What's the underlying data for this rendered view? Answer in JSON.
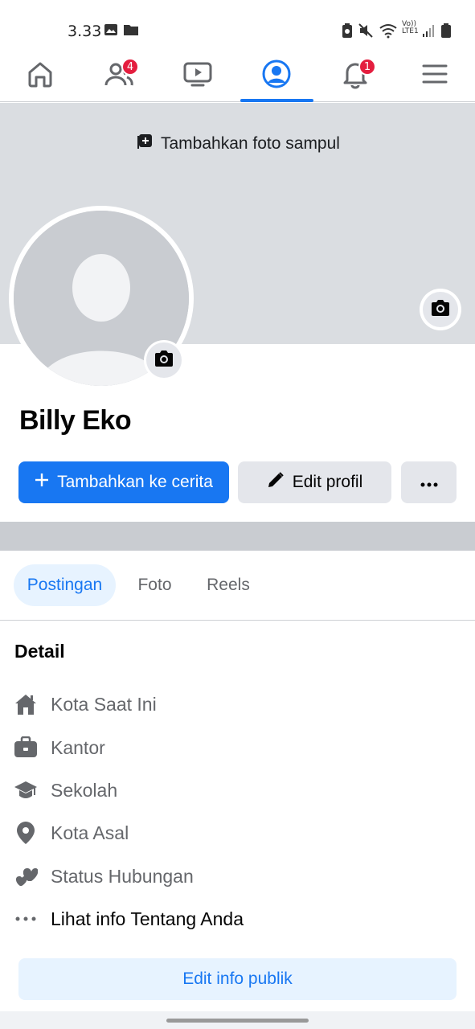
{
  "status_bar": {
    "time": "3.33",
    "network_label_top": "Vo))",
    "network_label_bottom": "LTE1"
  },
  "nav": {
    "items": [
      {
        "icon": "home-icon"
      },
      {
        "icon": "friends-icon",
        "badge": "4"
      },
      {
        "icon": "video-icon"
      },
      {
        "icon": "profile-icon",
        "active": true
      },
      {
        "icon": "bell-icon",
        "badge": "1"
      },
      {
        "icon": "menu-icon"
      }
    ],
    "accent": "#1877f2",
    "badge_color": "#e41e3f"
  },
  "cover": {
    "add_cover_label": "Tambahkan foto sampul"
  },
  "profile": {
    "name": "Billy Eko"
  },
  "actions": {
    "add_story_label": "Tambahkan ke cerita",
    "edit_profile_label": "Edit profil"
  },
  "tabs": [
    {
      "label": "Postingan",
      "active": true
    },
    {
      "label": "Foto"
    },
    {
      "label": "Reels"
    }
  ],
  "details": {
    "title": "Detail",
    "items": [
      {
        "icon": "house-icon",
        "label": "Kota Saat Ini"
      },
      {
        "icon": "briefcase-icon",
        "label": "Kantor"
      },
      {
        "icon": "graduation-cap-icon",
        "label": "Sekolah"
      },
      {
        "icon": "location-pin-icon",
        "label": "Kota Asal"
      },
      {
        "icon": "hearts-icon",
        "label": "Status Hubungan"
      },
      {
        "icon": "more-dots-icon",
        "label": "Lihat info Tentang Anda"
      }
    ],
    "edit_public_label": "Edit info publik"
  }
}
